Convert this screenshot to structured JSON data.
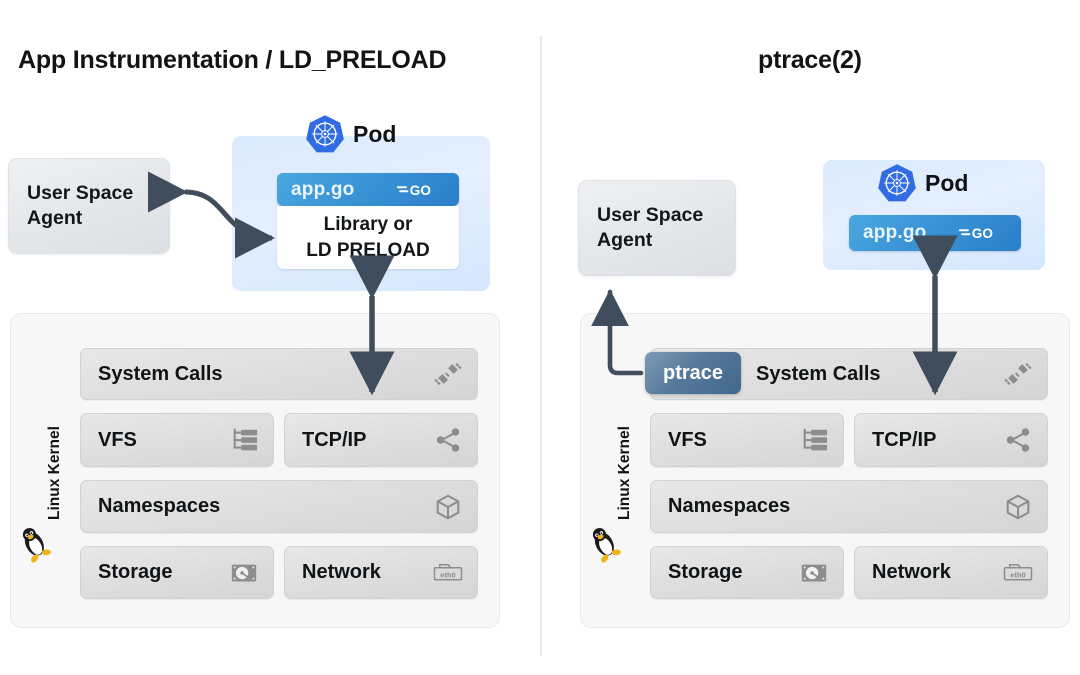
{
  "panels": [
    {
      "title": "App Instrumentation / LD_PRELOAD",
      "agent": {
        "line1": "User Space",
        "line2": "Agent"
      },
      "pod": {
        "label": "Pod",
        "logo_icon": "kubernetes-icon",
        "app": {
          "filename": "app.go",
          "logo_icon": "golang-icon"
        },
        "library": {
          "line1": "Library or",
          "line2": "LD PRELOAD"
        }
      },
      "kernel": {
        "label": "Linux Kernel",
        "logo_icon": "linux-tux-icon",
        "rows": [
          {
            "label": "System Calls",
            "icon": "plug-connector-icon"
          },
          {
            "label": "VFS",
            "icon": "file-tree-icon"
          },
          {
            "label": "TCP/IP",
            "icon": "share-network-icon"
          },
          {
            "label": "Namespaces",
            "icon": "cube-icon"
          },
          {
            "label": "Storage",
            "icon": "hard-disk-icon"
          },
          {
            "label": "Network",
            "icon": "nic-eth0-icon"
          }
        ]
      }
    },
    {
      "title": "ptrace(2)",
      "agent": {
        "line1": "User Space",
        "line2": "Agent"
      },
      "pod": {
        "label": "Pod",
        "logo_icon": "kubernetes-icon",
        "app": {
          "filename": "app.go",
          "logo_icon": "golang-icon"
        }
      },
      "kernel": {
        "label": "Linux Kernel",
        "logo_icon": "linux-tux-icon",
        "badge": "ptrace",
        "rows": [
          {
            "label": "System Calls",
            "icon": "plug-connector-icon"
          },
          {
            "label": "VFS",
            "icon": "file-tree-icon"
          },
          {
            "label": "TCP/IP",
            "icon": "share-network-icon"
          },
          {
            "label": "Namespaces",
            "icon": "cube-icon"
          },
          {
            "label": "Storage",
            "icon": "hard-disk-icon"
          },
          {
            "label": "Network",
            "icon": "nic-eth0-icon"
          }
        ]
      }
    }
  ],
  "colors": {
    "kubernetes_blue": "#326CE5",
    "go_blue": "#2a7fc9",
    "arrow_slate": "#3f4d5c",
    "ptrace_badge": "#56799a",
    "kernel_panel": "#f7f7f7",
    "kernel_row": "#dddddd",
    "pod_fill": "#dbeaff",
    "agent_fill": "#e3e6e9"
  },
  "nic_label": "eth0"
}
